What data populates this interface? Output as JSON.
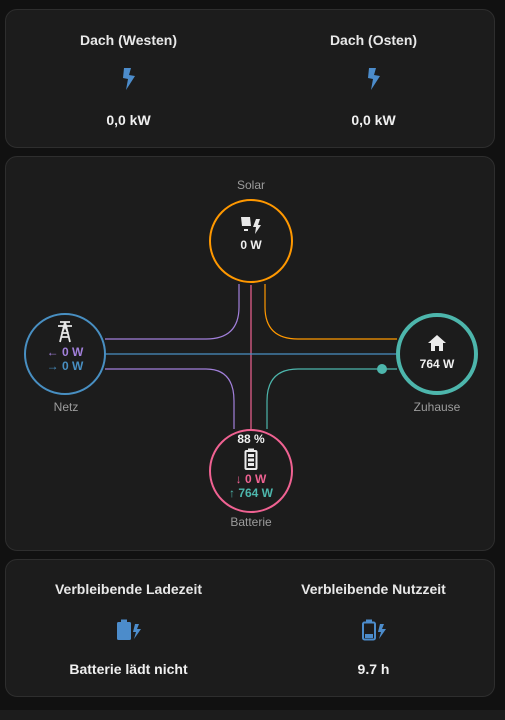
{
  "solar_card": {
    "west": {
      "title": "Dach (Westen)",
      "value": "0,0 kW",
      "icon": "lightning-icon"
    },
    "east": {
      "title": "Dach (Osten)",
      "value": "0,0 kW",
      "icon": "lightning-icon"
    }
  },
  "flow": {
    "solar": {
      "label": "Solar",
      "value": "0 W",
      "icon": "solar-panel-icon"
    },
    "grid": {
      "label": "Netz",
      "import": "← 0 W",
      "export": "→ 0 W",
      "icon": "transmission-tower-icon"
    },
    "home": {
      "label": "Zuhause",
      "value": "764 W",
      "icon": "home-icon"
    },
    "battery": {
      "label": "Batterie",
      "soc": "88 %",
      "in": "↓ 0 W",
      "out": "↑ 764 W",
      "icon": "battery-icon"
    },
    "colors": {
      "solar": "#ff9800",
      "grid": "#488fc2",
      "home": "#4db6ac",
      "battery": "#f06292",
      "grid_to_battery": "#a280db"
    }
  },
  "battery_card": {
    "charge": {
      "title": "Verbleibende Ladezeit",
      "value": "Batterie lädt nicht",
      "icon": "battery-charging-icon"
    },
    "use": {
      "title": "Verbleibende Nutzzeit",
      "value": "9.7 h",
      "icon": "battery-low-icon"
    }
  }
}
